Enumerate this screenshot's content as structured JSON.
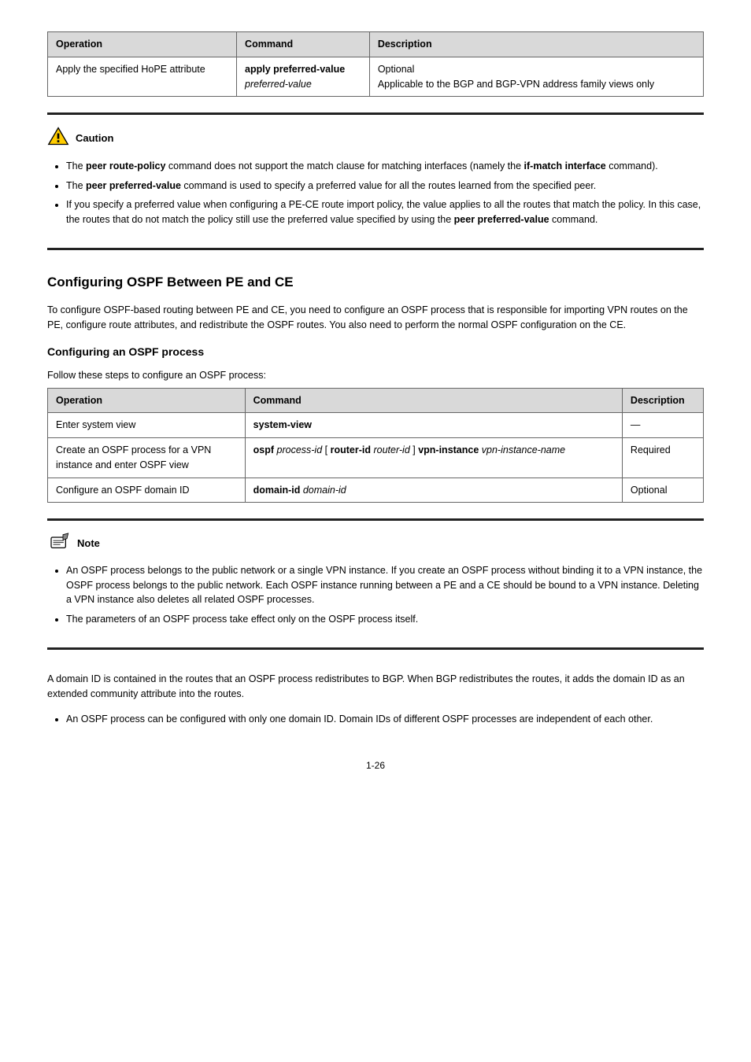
{
  "table1": {
    "headers": [
      "Operation",
      "Command",
      "Description"
    ],
    "rows": [
      {
        "op": "Apply the specified HoPE attribute",
        "cmd_lines": [
          "apply preferred-value",
          "preferred-value"
        ],
        "desc_lines": [
          "Optional",
          "Applicable to the BGP and BGP-VPN address family views only"
        ]
      }
    ]
  },
  "caution": {
    "label": "Caution",
    "items": [
      "The <b>peer route-policy</b> command does not support the match clause for matching interfaces (namely the <b>if-match interface</b> command).",
      "The <b>peer preferred-value</b> command is used to specify a preferred value for all the routes learned from the specified peer.",
      "If you specify a preferred value when configuring a PE-CE route import policy, the value applies to all the routes that match the policy. In this case, the routes that do not match the policy still use the preferred value specified by using the <b>peer preferred-value</b> command."
    ]
  },
  "section_heading": "Configuring OSPF Between PE and CE",
  "body_paragraph": "To configure OSPF-based routing between PE and CE, you need to configure an OSPF process that is responsible for importing VPN routes on the PE, configure route attributes, and redistribute the OSPF routes. You also need to perform the normal OSPF configuration on the CE.",
  "subheading": "Configuring an OSPF process",
  "proc_intro": "Follow these steps to configure an OSPF process:",
  "table2": {
    "headers": [
      "Operation",
      "Command",
      "Description"
    ],
    "rows": [
      {
        "op": "Enter system view",
        "cmd": "system-view",
        "desc": "—"
      },
      {
        "op_parts": [
          "Create an OSPF process for a VPN",
          " instance and enter OSPF view"
        ],
        "cmd_parts": [
          "ospf ",
          "process-id ",
          "[ ",
          "router-id",
          " router-id",
          " ] ",
          "vpn-instance ",
          "vpn-instance-name"
        ],
        "desc": "Required"
      },
      {
        "op": "Configure an OSPF domain ID",
        "cmd_parts": [
          "domain-id ",
          "domain-id"
        ],
        "desc": "Optional"
      }
    ]
  },
  "note": {
    "label": "Note",
    "items": [
      "An OSPF process belongs to the public network or a single VPN instance. If you create an OSPF process without binding it to a VPN instance, the OSPF process belongs to the public network. Each OSPF instance running between a PE and a CE should be bound to a VPN instance. Deleting a VPN instance also deletes all related OSPF processes.",
      "The parameters of an OSPF process take effect only on the OSPF process itself."
    ]
  },
  "closing_para": "A domain ID is contained in the routes that an OSPF process redistributes to BGP. When BGP redistributes the routes, it adds the domain ID as an extended community attribute into the routes.",
  "closing_bullets": [
    "An OSPF process can be configured with only one domain ID. Domain IDs of different OSPF processes are independent of each other."
  ],
  "page_number": "1-26"
}
